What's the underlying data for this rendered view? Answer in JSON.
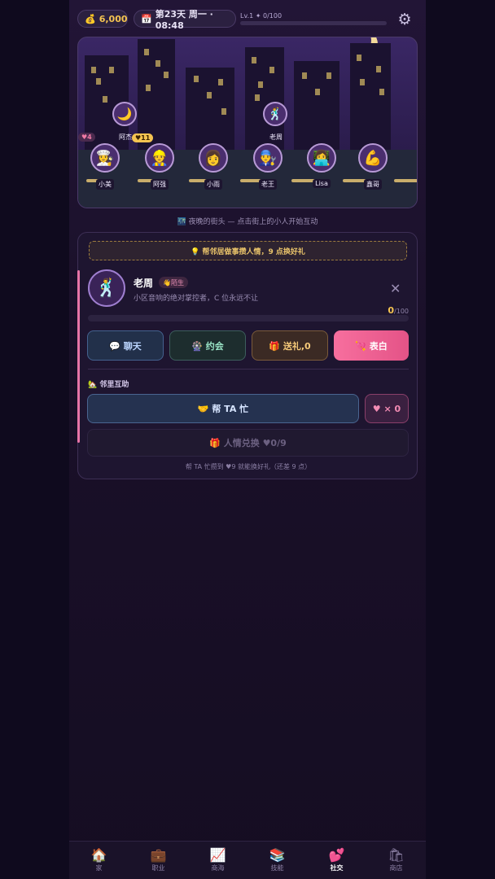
{
  "topbar": {
    "coins_icon": "money-bag-icon",
    "coins": "6,000",
    "calendar_icon": "calendar-icon",
    "day": "第23天 周一 · 08:48",
    "level": "Lv.1 ✦ 0/100",
    "level_progress": 0,
    "settings_icon": "gear-icon"
  },
  "scene": {
    "caption": "🌃 夜晚的街头 — 点击街上的小人开始互动",
    "npcs": [
      {
        "name": "小美",
        "emoji": "👩‍🍳",
        "hearts": "♥4"
      },
      {
        "name": "阿强",
        "emoji": "👷",
        "hearts": ""
      },
      {
        "name": "小雨",
        "emoji": "👩",
        "hearts": ""
      },
      {
        "name": "老王",
        "emoji": "👨‍🔧",
        "hearts": ""
      },
      {
        "name": "Lisa",
        "emoji": "👩‍💻",
        "hearts": ""
      },
      {
        "name": "鑫哥",
        "emoji": "💪",
        "hearts": ""
      }
    ],
    "walkers": [
      {
        "name": "阿杰",
        "emoji": "🌙",
        "badge": "♥11"
      },
      {
        "name": "老周",
        "emoji": "🕺",
        "badge": ""
      }
    ]
  },
  "panel": {
    "tip": "💡 帮邻居做事攒人情，9 点换好礼",
    "npc": {
      "name": "老周",
      "emoji": "🕺",
      "relation": "👋陌生",
      "desc": "小区音响的绝对掌控者，C 位永远不让",
      "affection": "0",
      "affection_max": "/100",
      "affection_progress": 0
    },
    "close_icon": "close-icon",
    "actions": {
      "chat": "💬 聊天",
      "date": "🎡 约会",
      "gift": "🎁 送礼,0",
      "confess": "💘 表白"
    },
    "neighbor_title": "🏡 邻里互助",
    "help_button": "🤝 帮 TA 忙",
    "heart_count": "♥ × 0",
    "exchange": "🎁 人情兑换 ♥0/9",
    "hint": "帮 TA 忙攒到 ♥9 就能换好礼（还差 9 点）"
  },
  "nav": [
    {
      "label": "家",
      "icon": "🏠",
      "icon_name": "house-icon"
    },
    {
      "label": "职业",
      "icon": "💼",
      "icon_name": "briefcase-icon"
    },
    {
      "label": "商海",
      "icon": "📈",
      "icon_name": "chart-icon"
    },
    {
      "label": "技能",
      "icon": "📚",
      "icon_name": "books-icon"
    },
    {
      "label": "社交",
      "icon": "💕",
      "icon_name": "hearts-icon"
    },
    {
      "label": "商店",
      "icon": "🛍",
      "icon_name": "shopping-bag-icon"
    }
  ],
  "active_tab": "社交"
}
